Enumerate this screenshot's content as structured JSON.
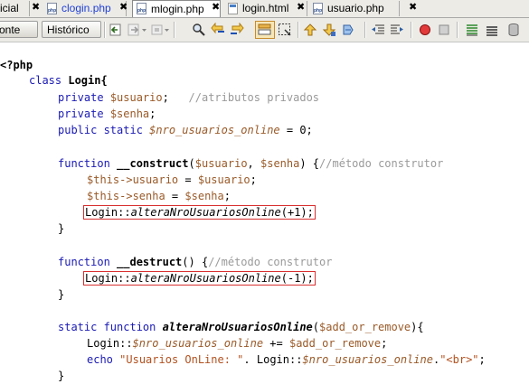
{
  "tabs": [
    {
      "label": "icial",
      "active": false,
      "has_file_icon": false
    },
    {
      "label": "clogin.php",
      "active": false,
      "has_file_icon": true,
      "link_style": true
    },
    {
      "label": "mlogin.php",
      "active": true,
      "has_file_icon": true
    },
    {
      "label": "login.html",
      "active": false,
      "has_file_icon": true,
      "html": true
    },
    {
      "label": "usuario.php",
      "active": false,
      "has_file_icon": true
    }
  ],
  "toolbar": {
    "source_label": "onte",
    "history_label": "Histórico",
    "icons": [
      "back-icon",
      "forward-icon",
      "forward-dropdown-icon",
      "last-edit-icon",
      "last-edit-dropdown-icon",
      "find-icon",
      "find-previous-icon",
      "find-next-icon",
      "toggle-highlight-icon",
      "find-selection-icon",
      "previous-bookmark-icon",
      "next-bookmark-icon",
      "toggle-bookmark-icon",
      "shift-left-icon",
      "shift-right-icon",
      "comment-icon",
      "uncomment-icon",
      "start-macro-icon",
      "stop-macro-icon",
      "diff-icon",
      "tasks-icon",
      "database-icon"
    ]
  },
  "code": {
    "open_tag": "<?php",
    "class_kw": "class",
    "class_name": "Login{",
    "private_kw": "private",
    "public_static_kw": "public static",
    "function_kw": "function",
    "static_function_kw": "static function",
    "echo_kw": "echo",
    "var_usuario": "$usuario",
    "semicolon_comment_sep": ";",
    "comment_atributos": "//atributos privados",
    "var_senha": "$senha",
    "semicolon": ";",
    "var_nro": "$nro_usuarios_online",
    "assign_zero": " = 0;",
    "construct_name": "__construct",
    "construct_args_open": "(",
    "construct_args_sep": ", ",
    "construct_args_close": ") {",
    "comment_construtor": "//método construtor",
    "this_usuario_lhs": "$this->",
    "prop_usuario": "usuario",
    "assign_op": " = ",
    "this_senha_lhs": "$this->",
    "prop_senha": "senha",
    "call_class": "Login::",
    "call_method": "alteraNroUsuariosOnline",
    "call_plus": "(+1);",
    "call_minus": "(-1);",
    "close_brace": "}",
    "destruct_name": "__destruct",
    "destruct_args": "() {",
    "comment_destrutor": "//método construtor",
    "static_method_name": "alteraNroUsuariosOnline",
    "static_args_open": "(",
    "static_param": "$add_or_remove",
    "static_args_close": "){",
    "inc_prefix": "Login::",
    "inc_var": "$nro_usuarios_online",
    "inc_op": " += ",
    "inc_rhs": "$add_or_remove",
    "echo_str": "\"Usuarios OnLine: \"",
    "echo_concat": ". Login::",
    "echo_var": "$nro_usuarios_online",
    "echo_dot": ".",
    "echo_br": "\"<br>\"",
    "echo_end": ";"
  },
  "colors": {
    "keyword": "#1a1ab4",
    "variable": "#9a5a28",
    "comment": "#9a9a9a",
    "string": "#b2511f",
    "highlight_box": "#d83030",
    "tab_link": "#1f3fd6"
  }
}
